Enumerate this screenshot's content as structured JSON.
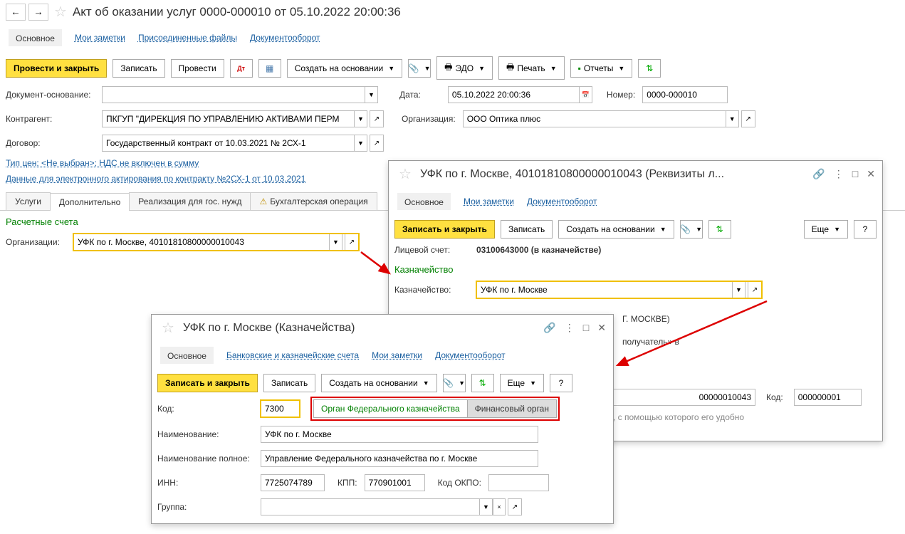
{
  "main": {
    "title": "Акт об оказании услуг 0000-000010 от 05.10.2022 20:00:36",
    "navtabs": {
      "active": "Основное",
      "notes": "Мои заметки",
      "files": "Присоединенные файлы",
      "docflow": "Документооборот"
    },
    "toolbar": {
      "post_close": "Провести и закрыть",
      "save": "Записать",
      "post": "Провести",
      "create_based": "Создать на основании",
      "edo": "ЭДО",
      "print": "Печать",
      "reports": "Отчеты"
    },
    "fields": {
      "doc_basis_label": "Документ-основание:",
      "date_label": "Дата:",
      "date_value": "05.10.2022 20:00:36",
      "number_label": "Номер:",
      "number_value": "0000-000010",
      "counterparty_label": "Контрагент:",
      "counterparty_value": "ПКГУП \"ДИРЕКЦИЯ ПО УПРАВЛЕНИЮ АКТИВАМИ ПЕРМ",
      "org_label": "Организация:",
      "org_value": "ООО Оптика плюс",
      "contract_label": "Договор:",
      "contract_value": "Государственный контракт от 10.03.2021 № 2СХ-1"
    },
    "links": {
      "price_type": "Тип цен: <Не выбран>; НДС не включен в сумму",
      "e_act": "Данные для электронного актирования по контракту №2СХ-1 от 10.03.2021"
    },
    "tabs": [
      "Услуги",
      "Дополнительно",
      "Реализация для гос. нужд",
      "Бухгалтерская операция"
    ],
    "tab_active": 1,
    "section_title": "Расчетные счета",
    "org_account_label": "Организации:",
    "org_account_value": "УФК по г. Москве, 40101810800000010043"
  },
  "win1": {
    "title": "УФК по г. Москве, 40101810800000010043 (Реквизиты л...",
    "navtabs": {
      "active": "Основное",
      "notes": "Мои заметки",
      "docflow": "Документооборот"
    },
    "toolbar": {
      "save_close": "Записать и закрыть",
      "save": "Записать",
      "create_based": "Создать на основании",
      "more": "Еще"
    },
    "acc_label": "Лицевой счет:",
    "acc_value": "03100643000 (в казначействе)",
    "section_title": "Казначейство",
    "treasury_label": "Казначейство:",
    "treasury_value": "УФК по г. Москве",
    "partial1": "Г. МОСКВЕ)",
    "partial2": "получатель» в",
    "partial3": "00000010043",
    "code_label": "Код:",
    "code_value": "000000001",
    "partial4": ", с помощью которого его удобно"
  },
  "win2": {
    "title": "УФК по г. Москве (Казначейства)",
    "navtabs": {
      "active": "Основное",
      "bank": "Банковские и казначейские счета",
      "notes": "Мои заметки",
      "docflow": "Документооборот"
    },
    "toolbar": {
      "save_close": "Записать и закрыть",
      "save": "Записать",
      "create_based": "Создать на основании",
      "more": "Еще"
    },
    "code_label": "Код:",
    "code_value": "7300",
    "toggle1": "Орган Федерального казначейства",
    "toggle2": "Финансовый орган",
    "name_label": "Наименование:",
    "name_value": "УФК по г. Москве",
    "full_label": "Наименование полное:",
    "full_value": "Управление Федерального казначейства по г. Москве",
    "inn_label": "ИНН:",
    "inn_value": "7725074789",
    "kpp_label": "КПП:",
    "kpp_value": "770901001",
    "okpo_label": "Код ОКПО:",
    "group_label": "Группа:"
  }
}
